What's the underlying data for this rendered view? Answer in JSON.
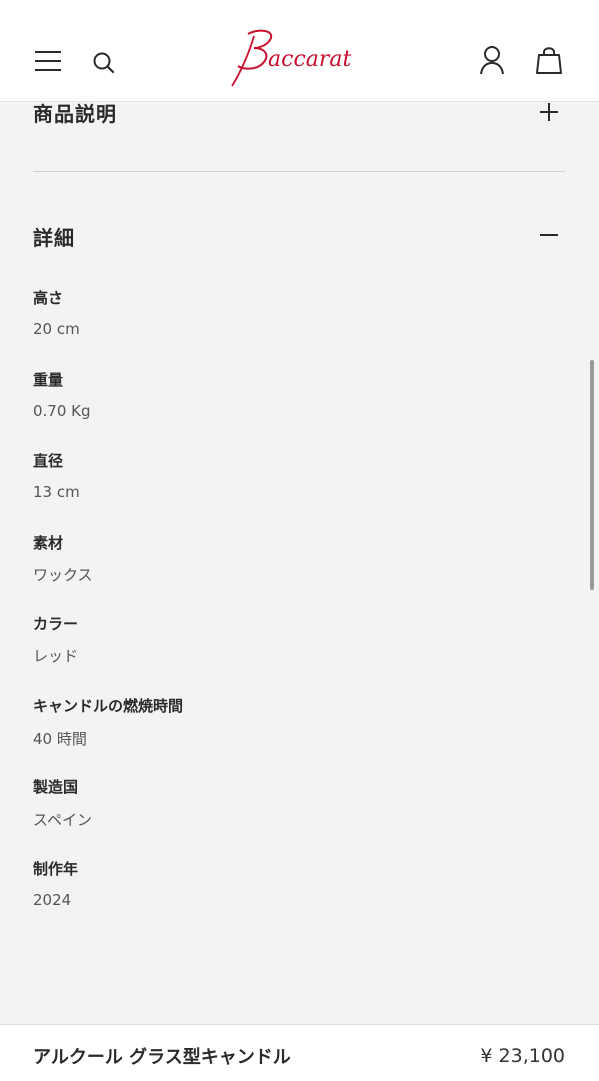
{
  "header": {
    "brand": "Baccarat",
    "brand_color": "#c8102e",
    "icons": [
      "menu-icon",
      "search-icon",
      "account-icon",
      "bag-icon"
    ]
  },
  "sections": {
    "description_title": "商品説明",
    "details_title": "詳細"
  },
  "details": [
    {
      "label": "高さ",
      "value": "20 cm"
    },
    {
      "label": "重量",
      "value": "0.70 Kg"
    },
    {
      "label": "直径",
      "value": "13 cm"
    },
    {
      "label": "素材",
      "value": "ワックス"
    },
    {
      "label": "カラー",
      "value": "レッド"
    },
    {
      "label": "キャンドルの燃焼時間",
      "value": "40 時間"
    },
    {
      "label": "製造国",
      "value": "スペイン"
    },
    {
      "label": "制作年",
      "value": "2024"
    }
  ],
  "footer": {
    "product_name": "アルクール グラス型キャンドル",
    "price": "¥ 23,100"
  }
}
